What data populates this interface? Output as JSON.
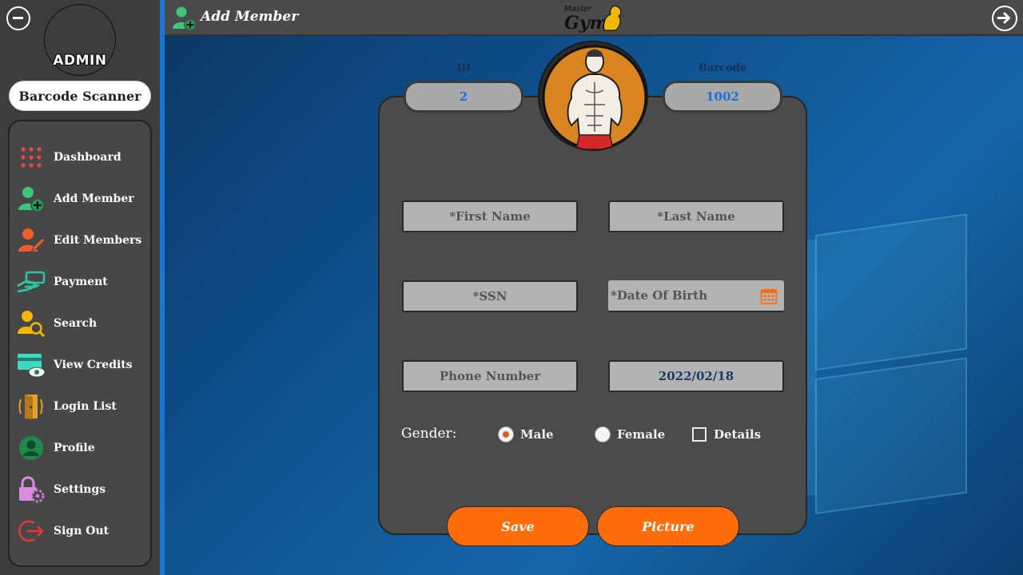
{
  "sidebar": {
    "role": "ADMIN",
    "barcode_button": "Barcode Scanner",
    "items": [
      {
        "label": "Dashboard",
        "icon": "grid-dots-icon"
      },
      {
        "label": "Add Member",
        "icon": "add-user-icon"
      },
      {
        "label": "Edit Members",
        "icon": "edit-user-icon"
      },
      {
        "label": "Payment",
        "icon": "payment-hand-icon"
      },
      {
        "label": "Search",
        "icon": "search-user-icon"
      },
      {
        "label": "View Credits",
        "icon": "credit-card-view-icon"
      },
      {
        "label": "Login List",
        "icon": "door-icon"
      },
      {
        "label": "Profile",
        "icon": "profile-icon"
      },
      {
        "label": "Settings",
        "icon": "settings-lock-icon"
      },
      {
        "label": "Sign Out",
        "icon": "sign-out-icon"
      }
    ]
  },
  "topbar": {
    "title": "Add Member",
    "logo_top": "Master",
    "logo_main": "Gym"
  },
  "form": {
    "id_label": "ID",
    "id_value": "2",
    "barcode_label": "Barcode",
    "barcode_value": "1002",
    "first_name_placeholder": "*First Name",
    "last_name_placeholder": "*Last Name",
    "ssn_placeholder": "*SSN",
    "dob_placeholder": "*Date Of Birth",
    "phone_placeholder": "Phone Number",
    "registration_date": "2022/02/18",
    "gender_label": "Gender:",
    "gender_options": [
      "Male",
      "Female"
    ],
    "gender_selected": "Male",
    "details_label": "Details",
    "details_checked": false,
    "save_label": "Save",
    "picture_label": "Picture"
  },
  "colors": {
    "accent": "#ff6d0a",
    "sidebar_edge": "#1e88e5",
    "panel": "#4b4b4b",
    "id_text": "#1c6fe0"
  }
}
